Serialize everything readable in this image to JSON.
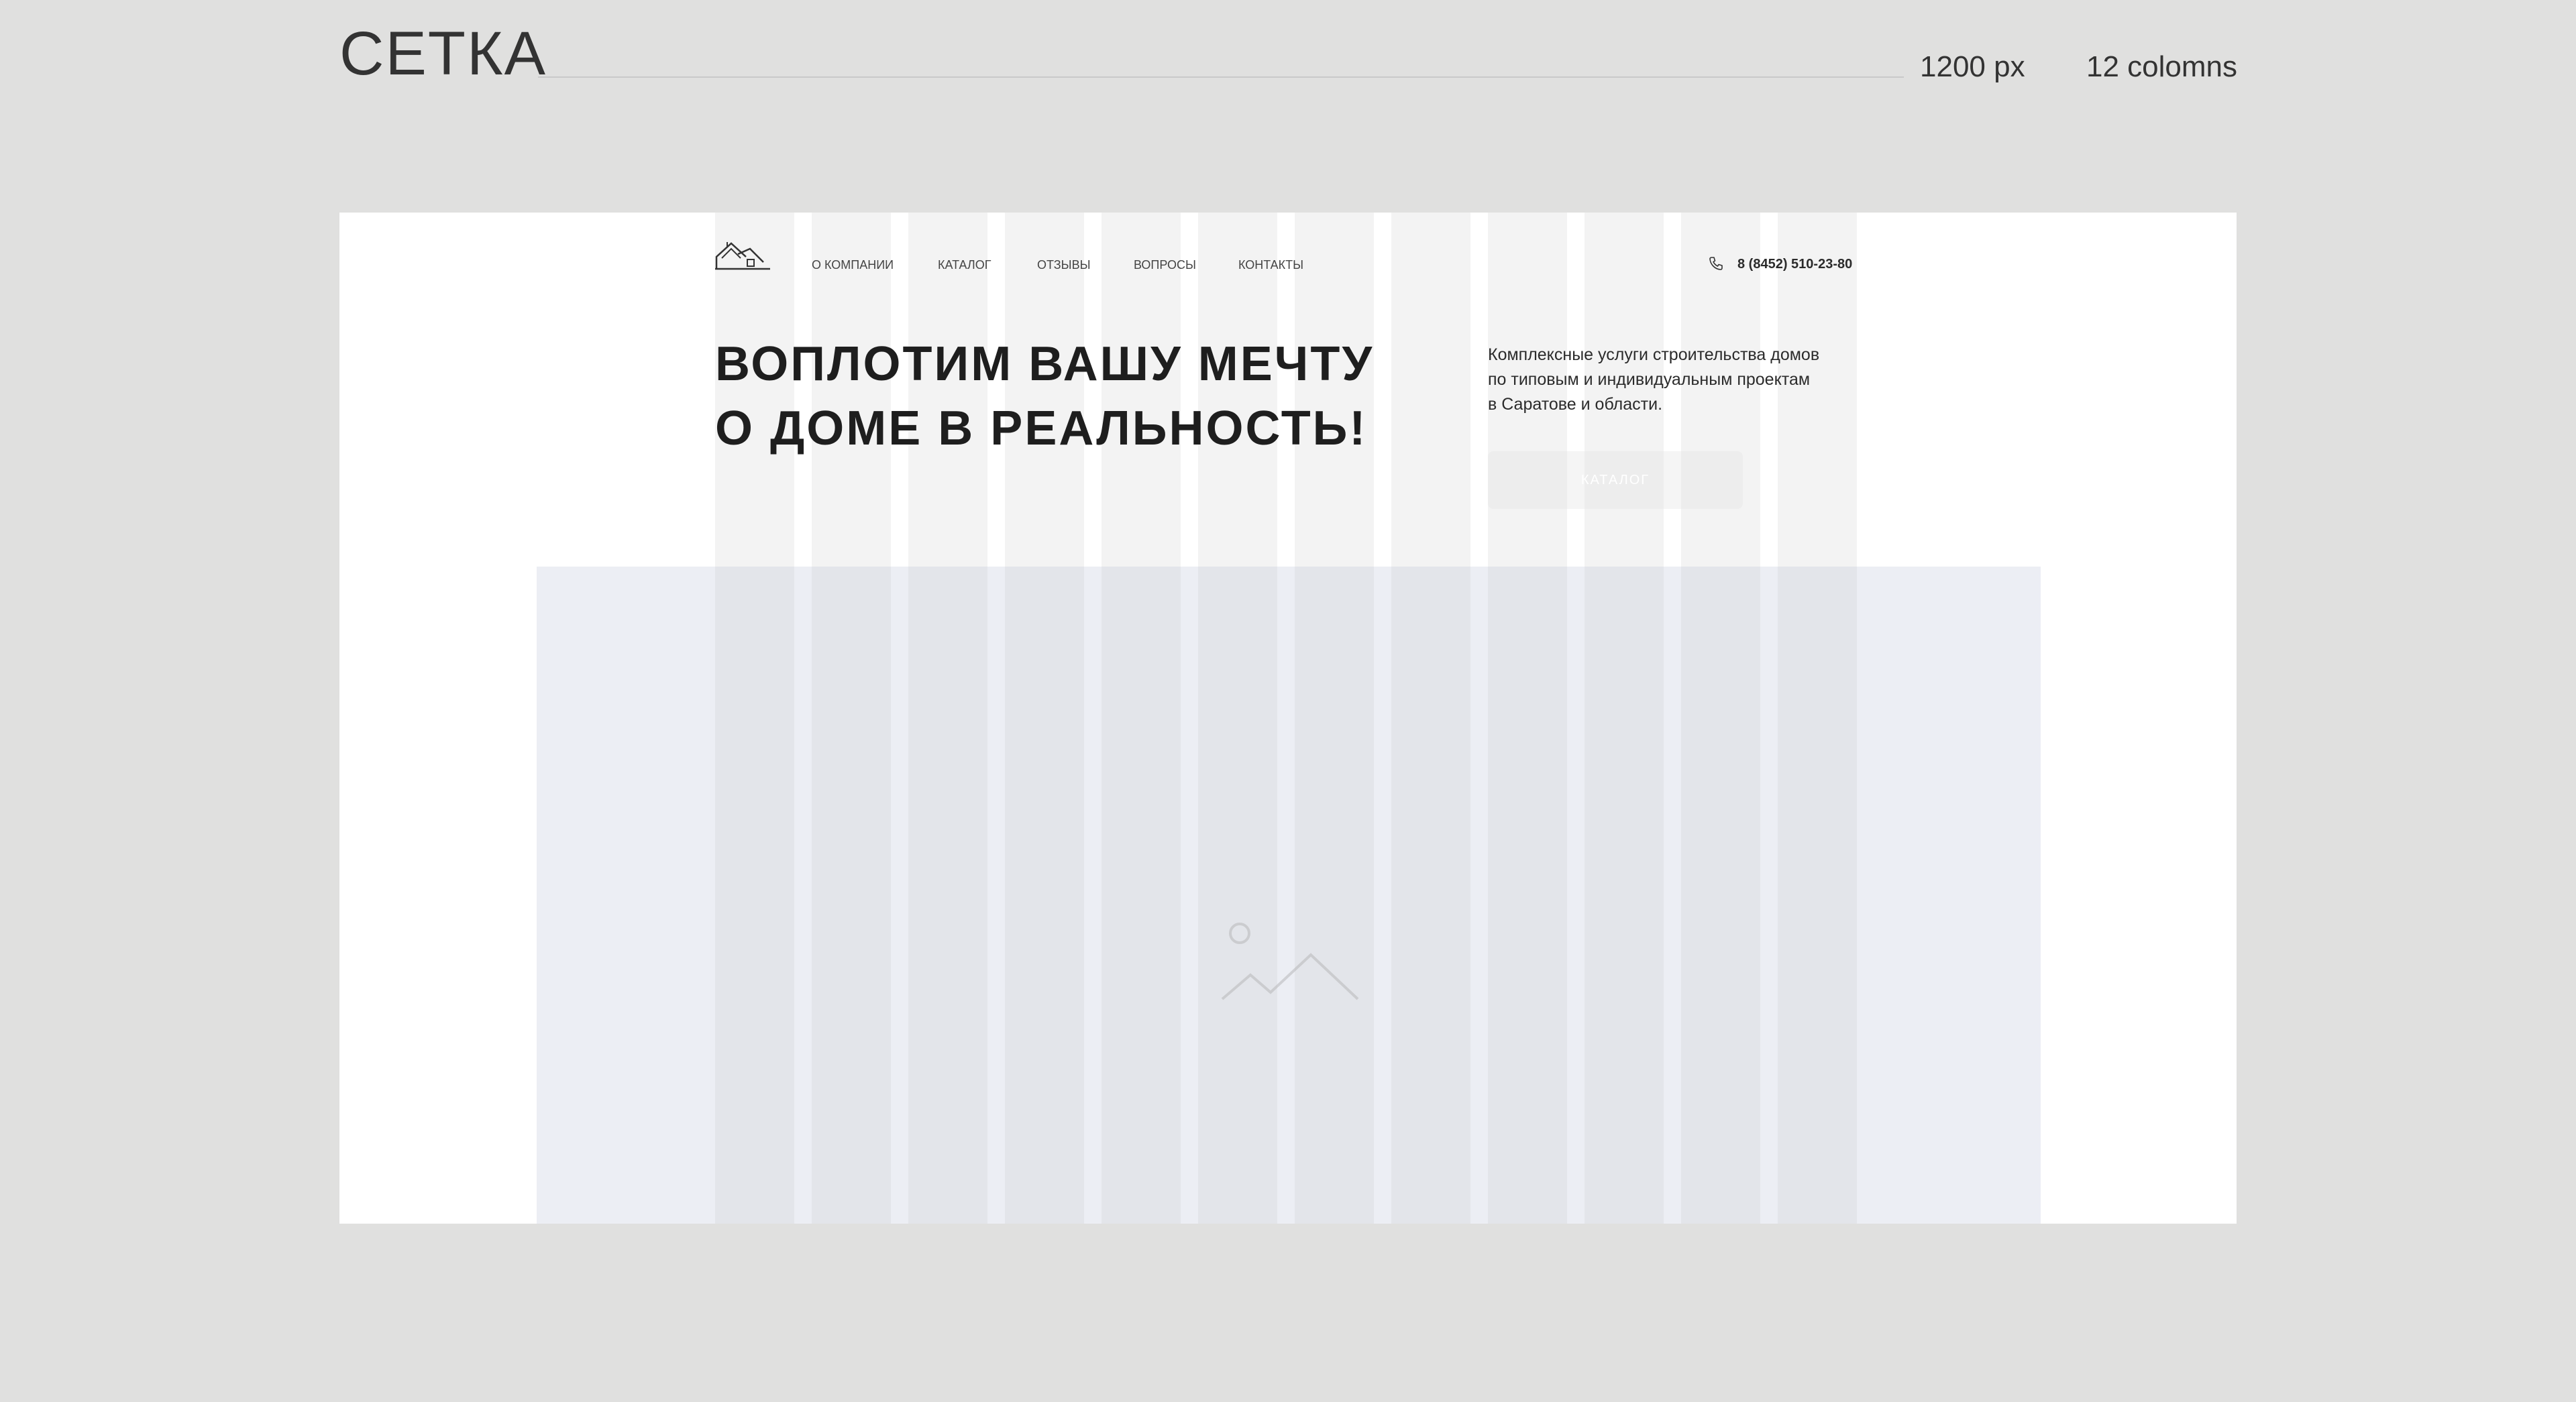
{
  "header": {
    "title": "СЕТКА",
    "width_label": "1200 px",
    "columns_label": "12 colomns"
  },
  "mockup": {
    "nav": {
      "items": [
        "О КОМПАНИИ",
        "КАТАЛОГ",
        "ОТЗЫВЫ",
        "ВОПРОСЫ",
        "КОНТАКТЫ"
      ],
      "phone": "8 (8452) 510-23-80"
    },
    "hero": {
      "title_line1": "ВОПЛОТИМ ВАШУ МЕЧТУ",
      "title_line2": "О ДОМЕ В РЕАЛЬНОСТЬ!",
      "description_line1": "Комплексные услуги строительства домов",
      "description_line2": "по типовым и индивидуальным проектам",
      "description_line3": "в Саратове и области.",
      "button_label": "КАТАЛОГ"
    },
    "grid_columns": 12,
    "icons": {
      "logo": "house-logo-icon",
      "phone": "phone-icon",
      "image_placeholder": "image-placeholder-icon"
    },
    "colors": {
      "background": "#e0e0df",
      "canvas": "#ffffff",
      "image_block": "#eceef4",
      "grid_column": "#f2f2f2"
    }
  }
}
